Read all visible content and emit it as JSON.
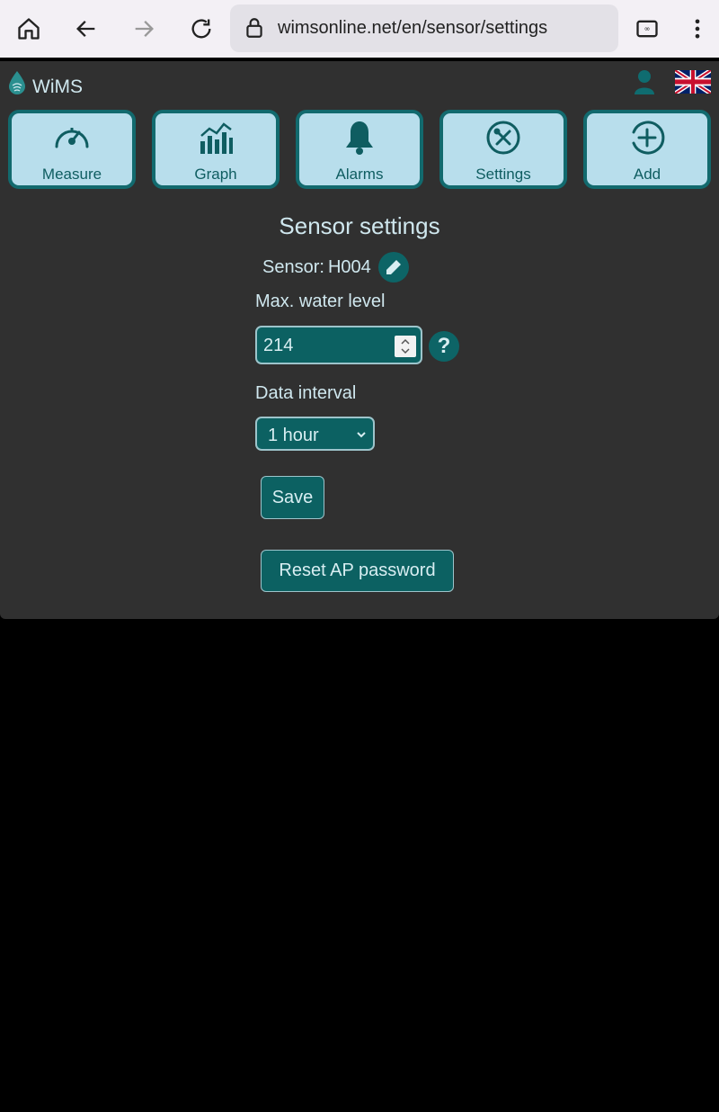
{
  "browser": {
    "url": "wimsonline.net/en/sensor/settings"
  },
  "app": {
    "brand": "WiMS",
    "nav": [
      {
        "label": "Measure",
        "icon": "speedometer-icon"
      },
      {
        "label": "Graph",
        "icon": "bar-chart-icon"
      },
      {
        "label": "Alarms",
        "icon": "bell-icon"
      },
      {
        "label": "Settings",
        "icon": "tools-icon"
      },
      {
        "label": "Add",
        "icon": "plus-circle-icon"
      }
    ],
    "title": "Sensor settings",
    "sensor": {
      "label": "Sensor:",
      "id": "H004"
    },
    "max_water_level": {
      "label": "Max. water level",
      "value": "214"
    },
    "data_interval": {
      "label": "Data interval",
      "selected": "1 hour"
    },
    "save_label": "Save",
    "reset_label": "Reset AP password",
    "help_glyph": "?"
  },
  "colors": {
    "accent": "#126a6e",
    "nav_bg": "#b8deec",
    "panel_bg": "#303030",
    "text": "#cfe7ee"
  }
}
